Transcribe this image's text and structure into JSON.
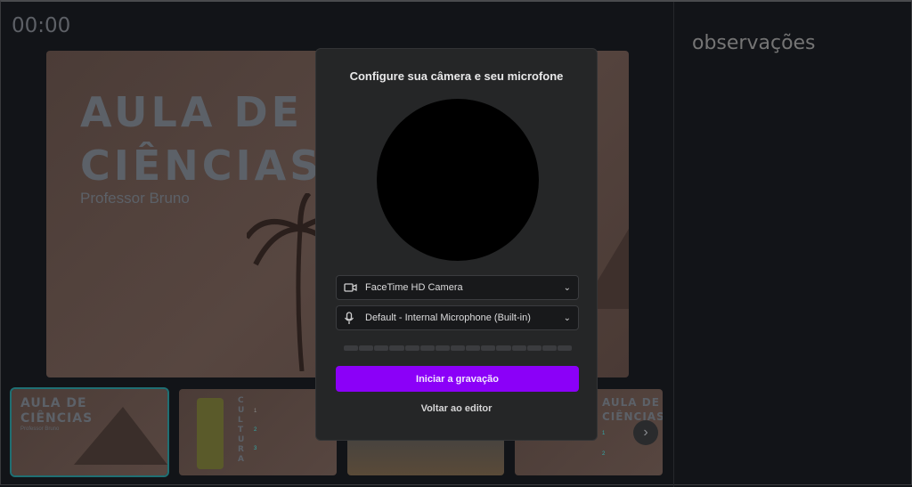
{
  "timer": "00:00",
  "notes": {
    "placeholder": "observações"
  },
  "slide": {
    "title_line1": "AULA DE",
    "title_line2": "CIÊNCIAS",
    "subtitle": "Professor Bruno"
  },
  "thumbnails": [
    {
      "title_line1": "AULA DE",
      "title_line2": "CIÊNCIAS",
      "subtitle": "Professor Bruno",
      "selected": true
    },
    {
      "vertical_title": "CULTURA",
      "numbers": [
        "1",
        "2",
        "3"
      ]
    },
    {},
    {
      "title_line1": "AULA DE",
      "title_line2": "CIÊNCIAS",
      "numbers": [
        "1",
        "2"
      ]
    }
  ],
  "next_icon": "chevron-right-icon",
  "modal": {
    "title": "Configure sua câmera e seu microfone",
    "camera_select": {
      "value": "FaceTime HD Camera",
      "icon": "camera-icon"
    },
    "mic_select": {
      "value": "Default - Internal Microphone (Built-in)",
      "icon": "microphone-icon"
    },
    "audio_level": 0,
    "start_button": "Iniciar a gravação",
    "back_link": "Voltar ao editor",
    "accent": "#8b00f8"
  }
}
